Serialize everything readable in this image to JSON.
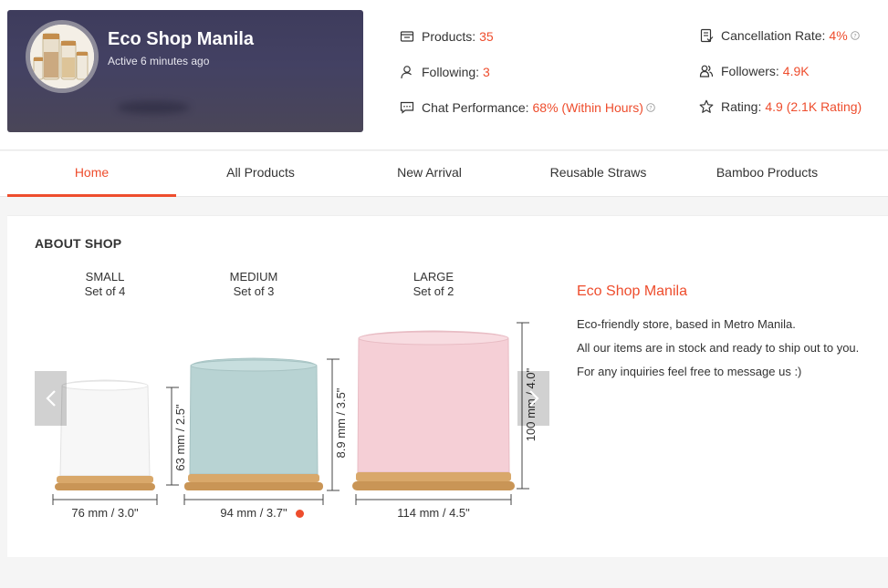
{
  "shop": {
    "name": "Eco Shop Manila",
    "active": "Active 6 minutes ago"
  },
  "stats": {
    "products": {
      "label": "Products:",
      "value": "35"
    },
    "following": {
      "label": "Following:",
      "value": "3"
    },
    "chat": {
      "label": "Chat Performance:",
      "value": "68% (Within Hours)"
    },
    "cancellation": {
      "label": "Cancellation Rate:",
      "value": "4%"
    },
    "followers": {
      "label": "Followers:",
      "value": "4.9K"
    },
    "rating": {
      "label": "Rating:",
      "value": "4.9 (2.1K Rating)"
    }
  },
  "tabs": [
    {
      "label": "Home",
      "active": true
    },
    {
      "label": "All Products"
    },
    {
      "label": "New Arrival"
    },
    {
      "label": "Reusable Straws"
    },
    {
      "label": "Bamboo Products"
    }
  ],
  "about": {
    "title": "ABOUT SHOP",
    "image": {
      "small": {
        "name": "SMALL",
        "set": "Set of 4",
        "height": "63 mm / 2.5\"",
        "width": "76 mm / 3.0\""
      },
      "medium": {
        "name": "MEDIUM",
        "set": "Set of 3",
        "height": "8.9 mm / 3.5\"",
        "width": "94 mm / 3.7\""
      },
      "large": {
        "name": "LARGE",
        "set": "Set of 2",
        "height": "100 mm / 4.0\"",
        "width": "114 mm / 4.5\""
      }
    },
    "shop_name": "Eco Shop Manila",
    "lines": [
      "Eco-friendly store, based in Metro Manila.",
      "All our items are in stock and ready to ship out to you.",
      "For any inquiries feel free to message us :)"
    ]
  },
  "colors": {
    "accent": "#ee4d2d",
    "card_bg": "#434163",
    "pot_white": "#f7f7f7",
    "pot_blue": "#b8d3d3",
    "pot_pink": "#f5cfd6",
    "bamboo": "#d9a86a"
  },
  "icons": [
    "store-icon",
    "user-icon",
    "chat-icon",
    "clipboard-icon",
    "users-icon",
    "star-icon",
    "help-icon",
    "chevron-left-icon",
    "chevron-right-icon"
  ]
}
